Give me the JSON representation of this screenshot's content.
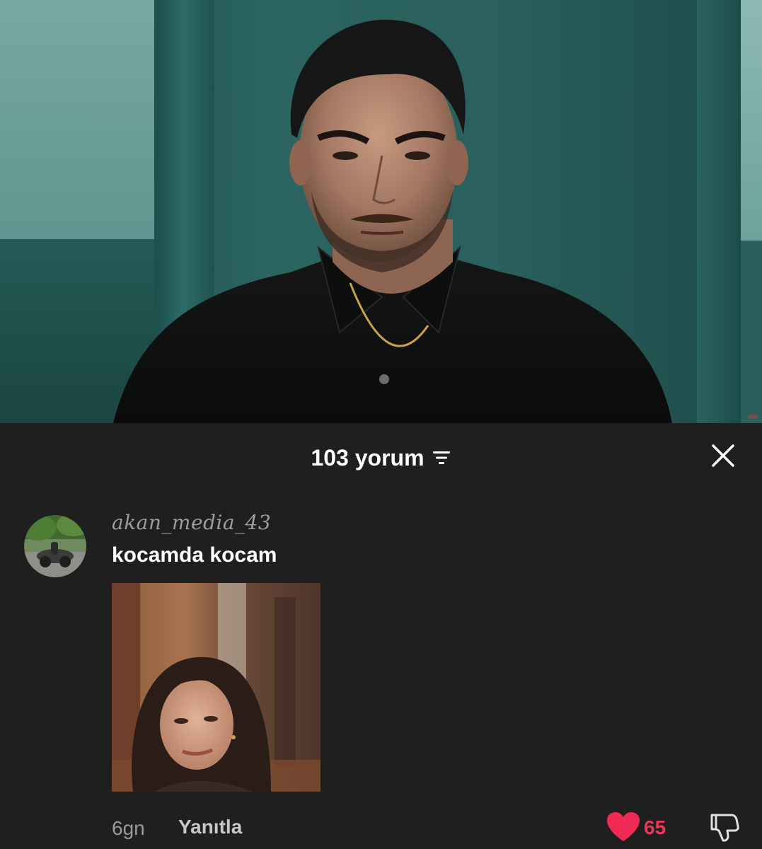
{
  "video": {
    "scene_icon": "video-frame"
  },
  "comments_panel": {
    "count_label": "103 yorum",
    "filter_icon": "filter-icon",
    "close_icon": "close-icon"
  },
  "comment": {
    "username": "akan_media_43",
    "text": "kocamda kocam",
    "time": "6gn",
    "reply_label": "Yanıtla",
    "like_count": "65",
    "like_icon": "heart-icon",
    "dislike_icon": "thumbs-down-icon"
  },
  "colors": {
    "background": "#1f1f1f",
    "like": "#f02a55",
    "text_primary": "#ffffff",
    "text_secondary": "#9a9a9a"
  }
}
